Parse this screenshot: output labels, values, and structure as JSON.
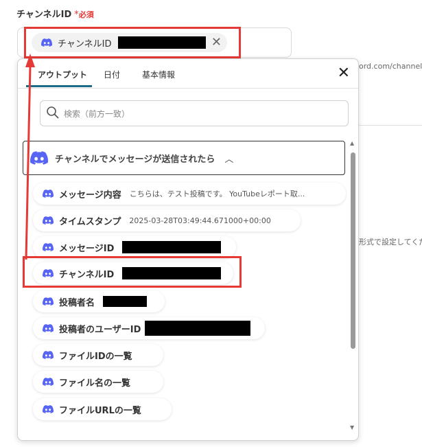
{
  "field": {
    "label": "チャンネルID",
    "required_star": "*",
    "required_text": "必須",
    "selected_chip_label": "チャンネルID",
    "clear_symbol": "✕"
  },
  "background": {
    "url_fragment": "ord.com/channel",
    "format_hint": "形式で設定してくだ"
  },
  "dropdown": {
    "tabs": [
      {
        "label": "アウトプット",
        "active": true
      },
      {
        "label": "日付",
        "active": false
      },
      {
        "label": "基本情報",
        "active": false
      }
    ],
    "close_symbol": "✕",
    "search_placeholder": "検索（前方一致）",
    "group_title": "チャンネルでメッセージが送信されたら",
    "group_chevron": "︿",
    "items": [
      {
        "label": "メッセージ内容",
        "value": "こちらは、テスト投稿です。 YouTubeレポート取..."
      },
      {
        "label": "タイムスタンプ",
        "value": "2025-03-28T03:49:44.671000+00:00"
      },
      {
        "label": "メッセージID",
        "value": ""
      },
      {
        "label": "チャンネルID",
        "value": ""
      },
      {
        "label": "投稿者名",
        "value": ""
      },
      {
        "label": "投稿者のユーザーID",
        "value": ""
      },
      {
        "label": "ファイルIDの一覧",
        "value": ""
      },
      {
        "label": "ファイル名の一覧",
        "value": ""
      },
      {
        "label": "ファイルURLの一覧",
        "value": ""
      }
    ],
    "scroll_up": "▲",
    "scroll_down": "▼"
  },
  "colors": {
    "discord_brand": "#5865F2",
    "highlight_red": "#e53935",
    "active_tab_underline": "#1a6b85",
    "required_red": "#e53935"
  },
  "icons": {
    "discord": "discord-icon",
    "search": "search-icon",
    "close": "close-icon",
    "chevron": "chevron-up-icon"
  }
}
